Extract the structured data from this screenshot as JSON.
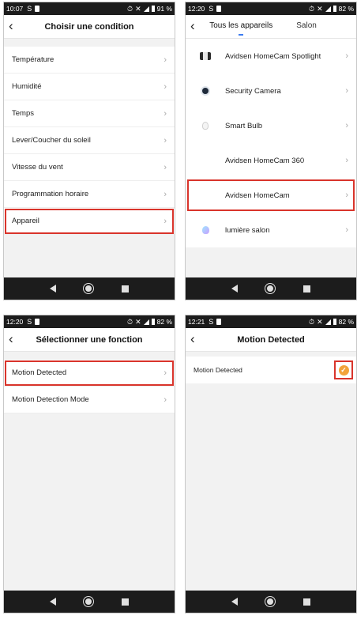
{
  "screen1": {
    "status": {
      "time": "10:07",
      "battery": "91 %"
    },
    "title": "Choisir une condition",
    "items": [
      {
        "label": "Température"
      },
      {
        "label": "Humidité"
      },
      {
        "label": "Temps"
      },
      {
        "label": "Lever/Coucher du soleil"
      },
      {
        "label": "Vitesse du vent"
      },
      {
        "label": "Programmation horaire"
      },
      {
        "label": "Appareil",
        "highlighted": true
      }
    ]
  },
  "screen2": {
    "status": {
      "time": "12:20",
      "battery": "82 %"
    },
    "tabs": [
      {
        "label": "Tous les appareils",
        "active": true
      },
      {
        "label": "Salon",
        "active": false
      }
    ],
    "devices": [
      {
        "label": "Avidsen HomeCam Spotlight",
        "icon": "spotlight-camera-icon"
      },
      {
        "label": "Security Camera",
        "icon": "security-camera-icon"
      },
      {
        "label": "Smart Bulb",
        "icon": "bulb-icon"
      },
      {
        "label": "Avidsen HomeCam 360",
        "icon": ""
      },
      {
        "label": "Avidsen HomeCam",
        "icon": "",
        "highlighted": true
      },
      {
        "label": "lumière salon",
        "icon": "color-bulb-icon"
      }
    ]
  },
  "screen3": {
    "status": {
      "time": "12:20",
      "battery": "82 %"
    },
    "title": "Sélectionner une fonction",
    "items": [
      {
        "label": "Motion Detected",
        "highlighted": true
      },
      {
        "label": "Motion Detection Mode"
      }
    ]
  },
  "screen4": {
    "status": {
      "time": "12:21",
      "battery": "82 %"
    },
    "title": "Motion Detected",
    "option": {
      "label": "Motion Detected",
      "checked": true,
      "check_color": "#f2a33a"
    }
  },
  "colors": {
    "highlight": "#d9342b",
    "tab_accent": "#3d7cf0"
  }
}
